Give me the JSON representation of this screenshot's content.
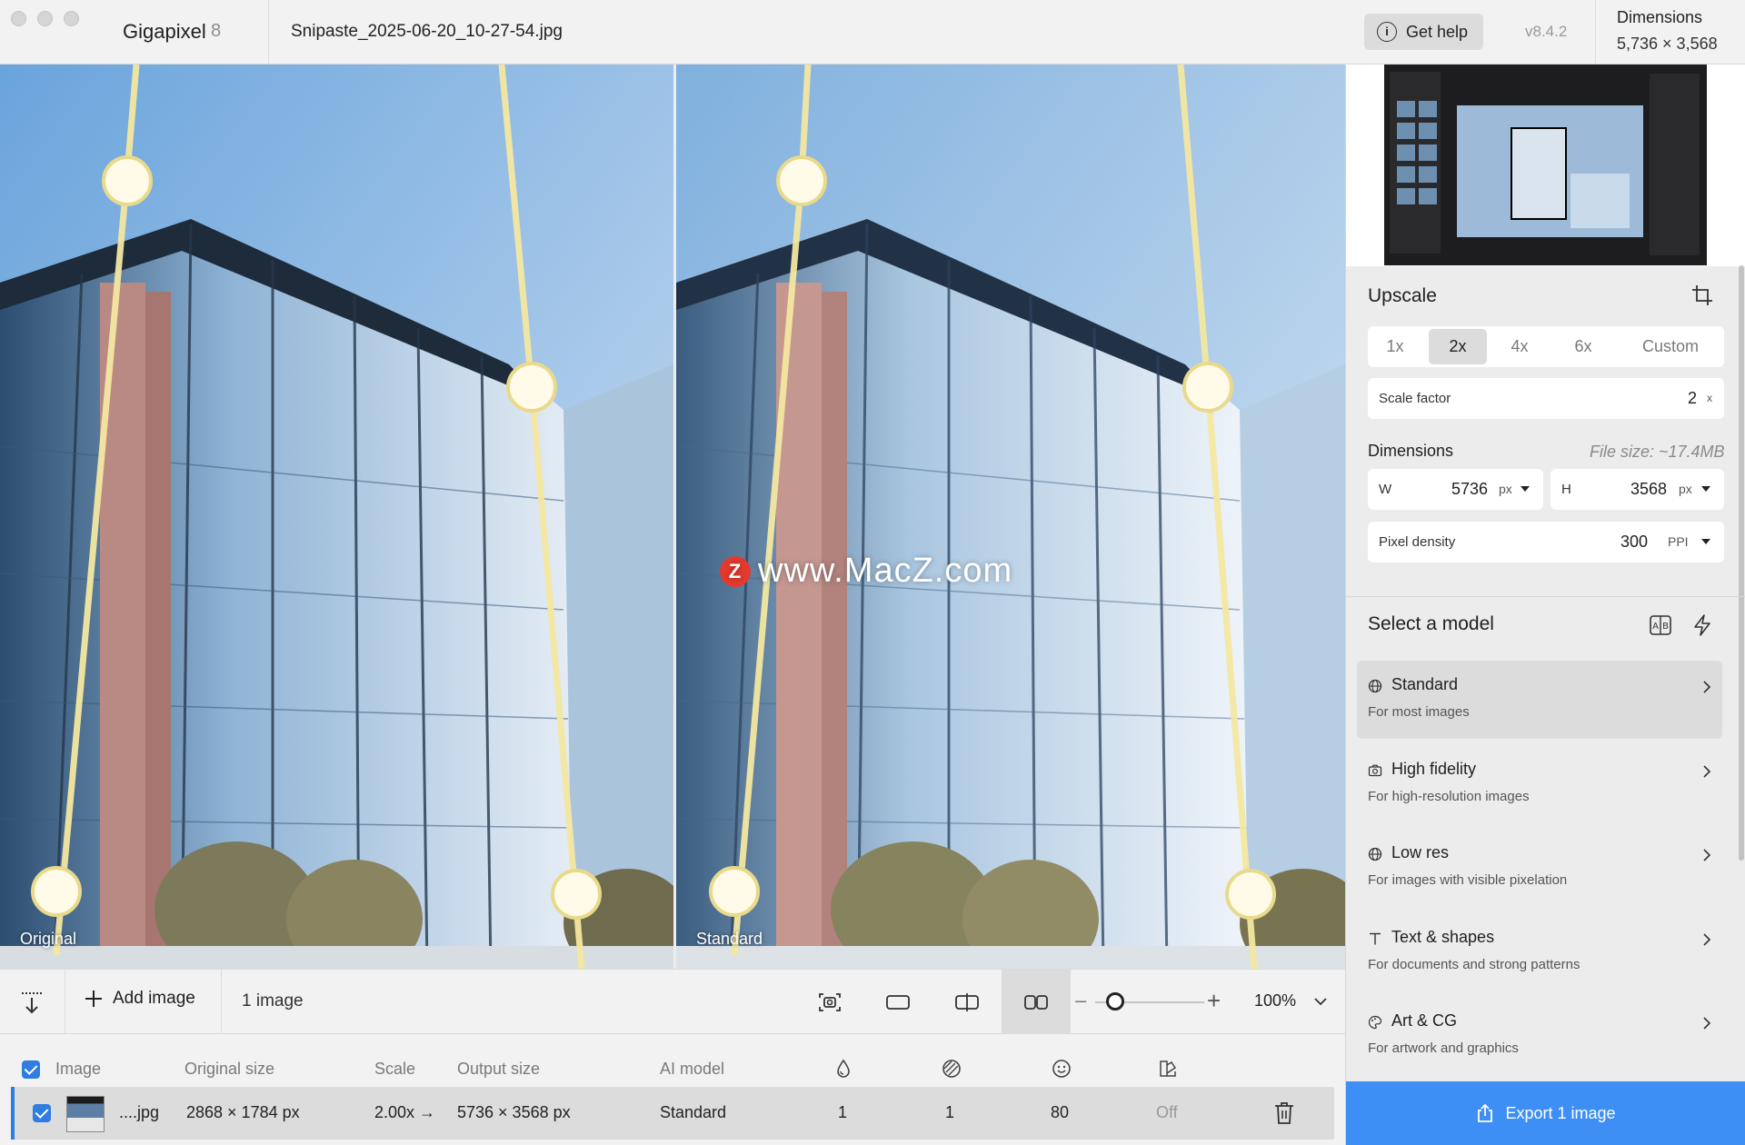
{
  "window": {
    "app_name": "Gigapixel",
    "app_version_major": "8",
    "file_name": "Snipaste_2025-06-20_10-27-54.jpg",
    "help_label": "Get help",
    "version": "v8.4.2",
    "dimensions_label": "Dimensions",
    "dimensions_value": "5,736 × 3,568"
  },
  "preview": {
    "left_label": "Original",
    "right_label": "Standard",
    "watermark_badge": "Z",
    "watermark_text": "www.MacZ.com"
  },
  "toolbar": {
    "add_image_label": "Add image",
    "image_count": "1 image",
    "zoom_value": "100%",
    "zoom_level": 0.12
  },
  "table": {
    "headers": {
      "image": "Image",
      "original_size": "Original size",
      "scale": "Scale",
      "output_size": "Output size",
      "ai_model": "AI model"
    },
    "rows": [
      {
        "name": "....jpg",
        "original_size": "2868 × 1784 px",
        "scale": "2.00x →",
        "output_size": "5736 × 3568 px",
        "ai_model": "Standard",
        "col1": "1",
        "col2": "1",
        "col3": "80",
        "col4": "Off"
      }
    ]
  },
  "upscale": {
    "title": "Upscale",
    "options": [
      "1x",
      "2x",
      "4x",
      "6x",
      "Custom"
    ],
    "selected": "2x",
    "scale_factor_label": "Scale factor",
    "scale_factor_value": "2",
    "scale_factor_unit": "x",
    "dimensions_label": "Dimensions",
    "file_size": "File size: ~17.4MB",
    "width_label": "W",
    "width_value": "5736",
    "width_unit": "px",
    "height_label": "H",
    "height_value": "3568",
    "height_unit": "px",
    "density_label": "Pixel density",
    "density_value": "300",
    "density_unit": "PPI"
  },
  "models": {
    "title": "Select a model",
    "items": [
      {
        "name": "Standard",
        "desc": "For most images",
        "icon": "globe-icon"
      },
      {
        "name": "High fidelity",
        "desc": "For high-resolution images",
        "icon": "camera-icon"
      },
      {
        "name": "Low res",
        "desc": "For images with visible pixelation",
        "icon": "globe-icon"
      },
      {
        "name": "Text & shapes",
        "desc": "For documents and strong patterns",
        "icon": "text-icon"
      },
      {
        "name": "Art & CG",
        "desc": "For artwork and graphics",
        "icon": "palette-icon"
      }
    ],
    "selected": "Standard"
  },
  "export": {
    "label": "Export 1 image"
  },
  "colors": {
    "accent": "#3d8ff5",
    "checkbox": "#2f7de1",
    "selected_bg": "#dcdcdc",
    "panel_bg": "#ececec"
  }
}
